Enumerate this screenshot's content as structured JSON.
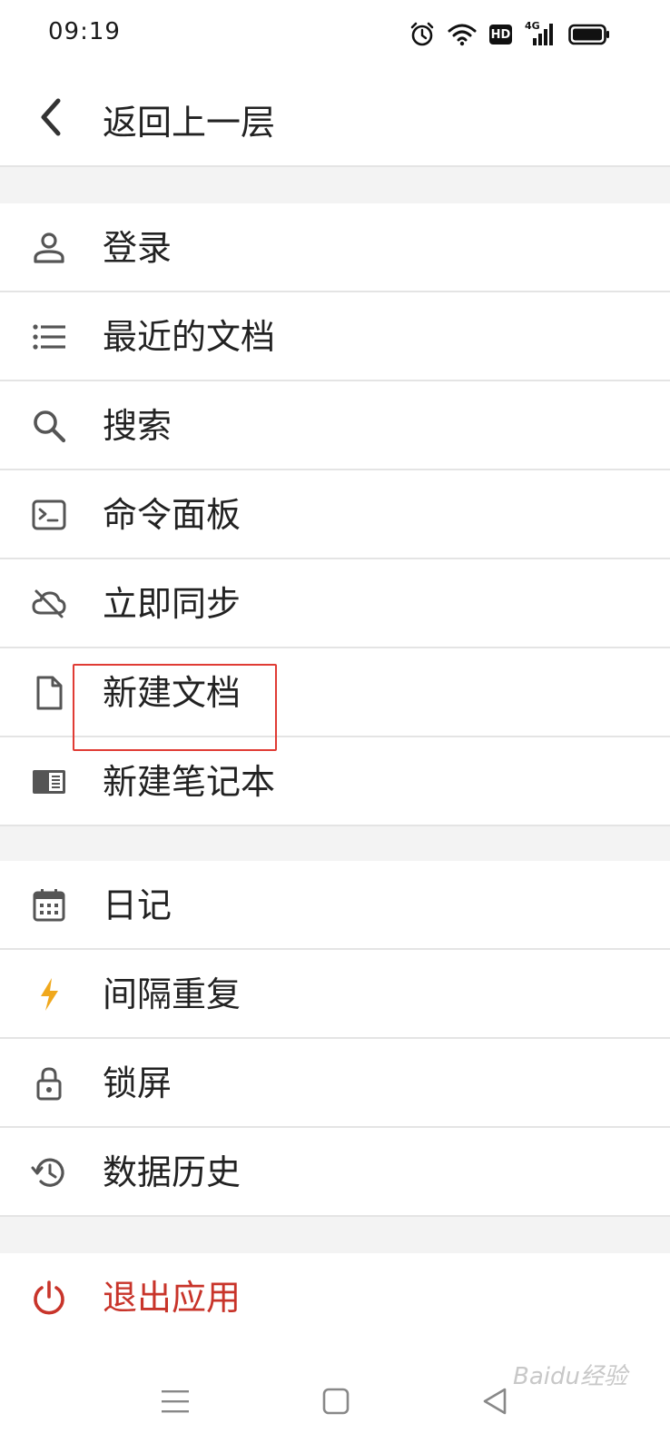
{
  "status_bar": {
    "time": "09:19",
    "hd": "HD",
    "network": "4G",
    "icons": [
      "alarm-icon",
      "wifi-icon",
      "hd-icon",
      "cellular-4g-icon",
      "battery-icon"
    ]
  },
  "header": {
    "back_label": "返回上一层"
  },
  "menu": {
    "group1": [
      {
        "label": "登录",
        "icon": "user-icon"
      },
      {
        "label": "最近的文档",
        "icon": "list-icon"
      },
      {
        "label": "搜索",
        "icon": "search-icon"
      },
      {
        "label": "命令面板",
        "icon": "terminal-icon"
      },
      {
        "label": "立即同步",
        "icon": "cloud-off-icon"
      },
      {
        "label": "新建文档",
        "icon": "document-icon"
      },
      {
        "label": "新建笔记本",
        "icon": "notebook-icon"
      }
    ],
    "group2": [
      {
        "label": "日记",
        "icon": "calendar-icon"
      },
      {
        "label": "间隔重复",
        "icon": "lightning-icon"
      },
      {
        "label": "锁屏",
        "icon": "lock-icon"
      },
      {
        "label": "数据历史",
        "icon": "history-icon"
      }
    ],
    "exit": {
      "label": "退出应用",
      "icon": "power-icon"
    }
  },
  "colors": {
    "accent_danger": "#c8342a",
    "lightning": "#f0a81c",
    "highlight_box": "#e03b34",
    "icon_gray": "#5a5a5a",
    "separator_bg": "#f3f3f3"
  },
  "watermark": {
    "text": "Baidu经验"
  },
  "navigation": [
    "menu-icon",
    "home-icon",
    "back-triangle-icon"
  ]
}
